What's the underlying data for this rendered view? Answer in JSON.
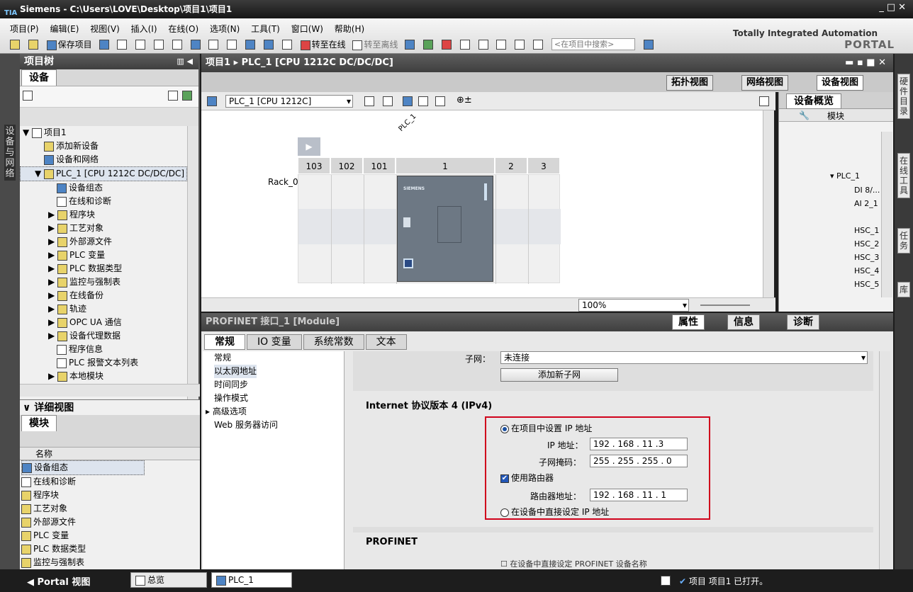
{
  "title": "Siemens  -  C:\\Users\\LOVE\\Desktop\\项目1\\项目1",
  "menu": [
    "项目(P)",
    "编辑(E)",
    "视图(V)",
    "插入(I)",
    "在线(O)",
    "选项(N)",
    "工具(T)",
    "窗口(W)",
    "帮助(H)"
  ],
  "toolbar": {
    "save": "保存项目",
    "go_online": "转至在线",
    "go_offline": "转至离线",
    "search_placeholder": "<在项目中搜索>"
  },
  "brand": {
    "line1": "Totally Integrated Automation",
    "line2": "PORTAL"
  },
  "left_tab": "设备与网络",
  "right_tabs": [
    "硬件目录",
    "在线工具",
    "任务",
    "库"
  ],
  "project_tree": {
    "header": "项目树",
    "tab": "设备",
    "items": [
      {
        "label": "项目1"
      },
      {
        "label": "添加新设备"
      },
      {
        "label": "设备和网络"
      },
      {
        "label": "PLC_1 [CPU 1212C DC/DC/DC]"
      },
      {
        "label": "设备组态"
      },
      {
        "label": "在线和诊断"
      },
      {
        "label": "程序块"
      },
      {
        "label": "工艺对象"
      },
      {
        "label": "外部源文件"
      },
      {
        "label": "PLC 变量"
      },
      {
        "label": "PLC 数据类型"
      },
      {
        "label": "监控与强制表"
      },
      {
        "label": "在线备份"
      },
      {
        "label": "轨迹"
      },
      {
        "label": "OPC UA 通信"
      },
      {
        "label": "设备代理数据"
      },
      {
        "label": "程序信息"
      },
      {
        "label": "PLC 报警文本列表"
      },
      {
        "label": "本地模块"
      }
    ]
  },
  "detail_view": {
    "header": "详细视图",
    "tab": "模块",
    "col": "名称",
    "items": [
      "设备组态",
      "在线和诊断",
      "程序块",
      "工艺对象",
      "外部源文件",
      "PLC 变量",
      "PLC 数据类型",
      "监控与强制表"
    ]
  },
  "main": {
    "breadcrumb": "项目1  ▸  PLC_1 [CPU 1212C DC/DC/DC]",
    "view_tabs": [
      "拓扑视图",
      "网络视图",
      "设备视图"
    ],
    "device_select": "PLC_1 [CPU 1212C]",
    "rack_label": "Rack_0",
    "plc_tag": "PLC_1",
    "slots": [
      "103",
      "102",
      "101",
      "1",
      "2",
      "3"
    ],
    "cpu_brand": "SIEMENS",
    "zoom": "100%"
  },
  "overview": {
    "tab": "设备概览",
    "col": "模块",
    "rows": [
      "PLC_1",
      "DI 8/...",
      "AI 2_1",
      "HSC_1",
      "HSC_2",
      "HSC_3",
      "HSC_4",
      "HSC_5"
    ]
  },
  "inspector": {
    "header": "PROFINET 接口_1 [Module]",
    "right_tabs": [
      "属性",
      "信息",
      "诊断"
    ],
    "tabs": [
      "常规",
      "IO 变量",
      "系统常数",
      "文本"
    ],
    "nav": [
      "常规",
      "以太网地址",
      "时间同步",
      "操作模式",
      "高级选项",
      "Web 服务器访问"
    ],
    "subnet_label": "子网：",
    "subnet_value": "未连接",
    "add_subnet": "添加新子网",
    "ipv4_title": "Internet 协议版本 4 (IPv4)",
    "set_ip_project": "在项目中设置 IP 地址",
    "ip_label": "IP 地址：",
    "ip_value": "192  .  168  .  11   .3",
    "mask_label": "子网掩码：",
    "mask_value": "255  .  255  .  255  .  0",
    "use_router": "使用路由器",
    "router_label": "路由器地址：",
    "router_value": "192  .  168  .  11   .  1",
    "set_ip_device": "在设备中直接设定 IP 地址",
    "profinet_title": "PROFINET",
    "profinet_item": "在设备中直接设定 PROFINET 设备名称"
  },
  "status": {
    "portal": "Portal 视图",
    "tabs": [
      "总览",
      "PLC_1"
    ],
    "message": "项目 项目1 已打开。"
  }
}
